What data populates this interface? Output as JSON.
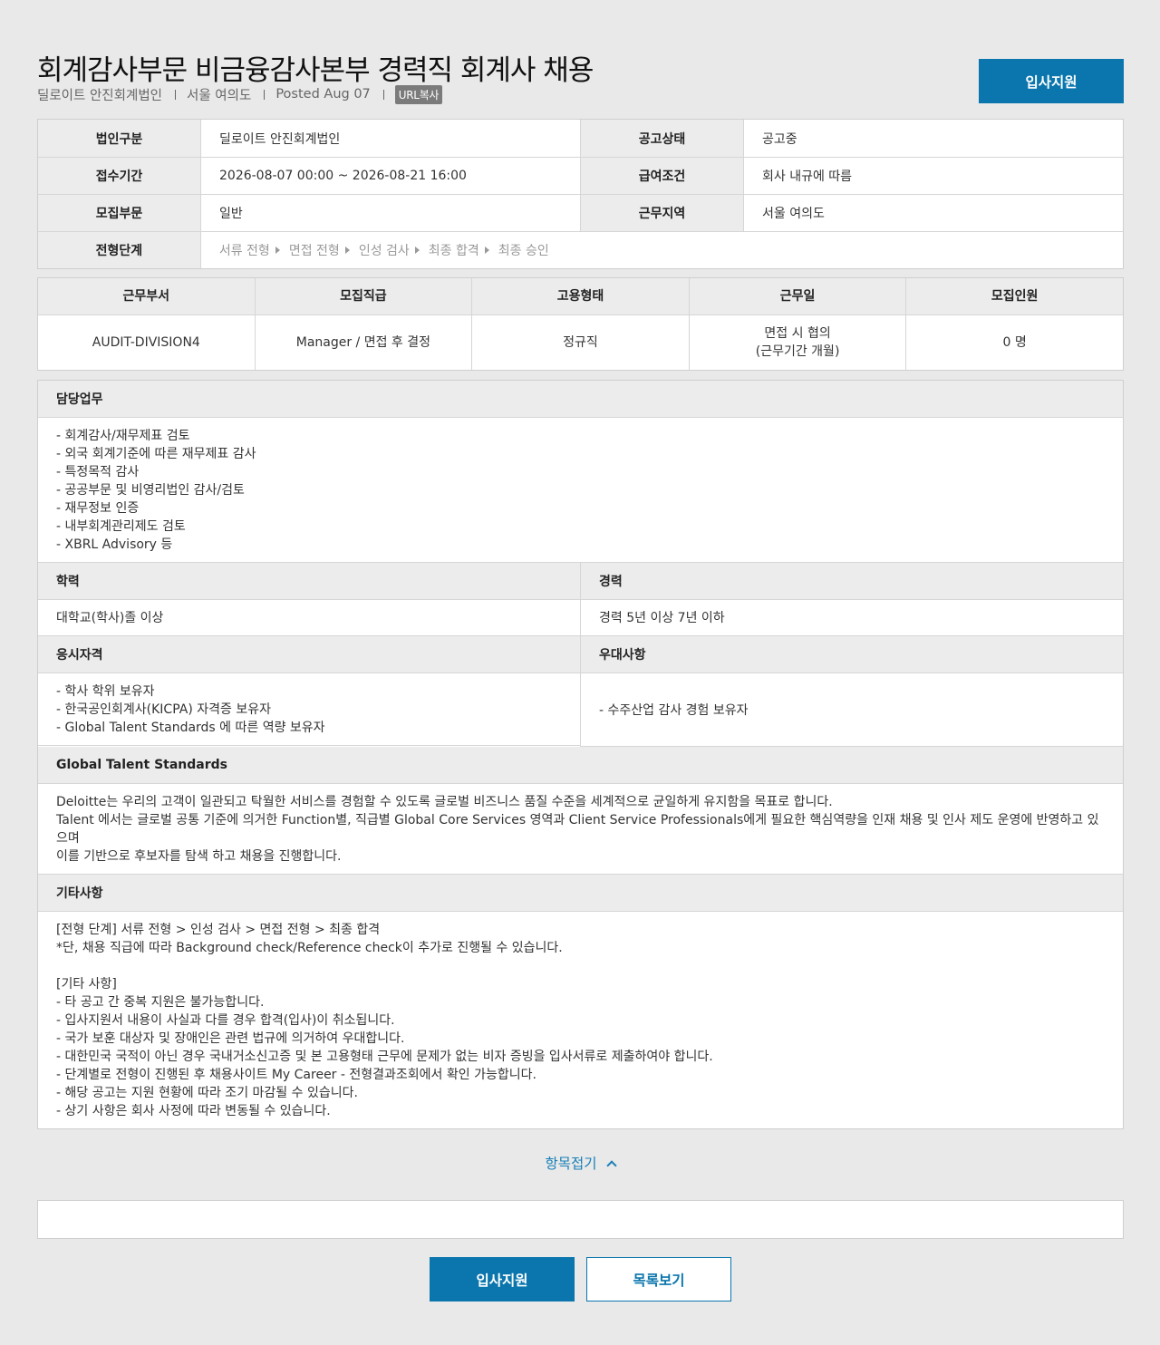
{
  "header": {
    "title": "회계감사부문 비금융감사본부 경력직 회계사 채용",
    "company": "딜로이트 안진회계법인",
    "location": "서울 여의도",
    "posted": "Posted Aug 07",
    "url_copy": "URL복사",
    "apply_label": "입사지원"
  },
  "info": {
    "corp_label": "법인구분",
    "corp_value": "딜로이트 안진회계법인",
    "status_label": "공고상태",
    "status_value": "공고중",
    "period_label": "접수기간",
    "period_value": "2026-08-07 00:00 ~ 2026-08-21 16:00",
    "salary_label": "급여조건",
    "salary_value": "회사 내규에 따름",
    "dept_label": "모집부문",
    "dept_value": "일반",
    "region_label": "근무지역",
    "region_value": "서울 여의도",
    "steps_label": "전형단계",
    "steps": [
      "서류 전형",
      "면접 전형",
      "인성 검사",
      "최종 합격",
      "최종 승인"
    ]
  },
  "positions": {
    "headers": [
      "근무부서",
      "모집직급",
      "고용형태",
      "근무일",
      "모집인원"
    ],
    "row": {
      "dept": "AUDIT-DIVISION4",
      "rank": "Manager / 면접 후 결정",
      "type": "정규직",
      "workday_1": "면접 시 협의",
      "workday_2": "(근무기간 개월)",
      "count": "0 명"
    }
  },
  "duties": {
    "title": "담당업무",
    "lines": [
      "- 회계감사/재무제표 검토",
      "- 외국 회계기준에 따른 재무제표 감사",
      "- 특정목적 감사",
      "- 공공부문 및 비영리법인 감사/검토",
      "- 재무정보 인증",
      "- 내부회계관리제도 검토",
      "- XBRL Advisory 등"
    ]
  },
  "education": {
    "title": "학력",
    "value": "대학교(학사)졸 이상"
  },
  "career": {
    "title": "경력",
    "value": "경력 5년 이상 7년 이하"
  },
  "qualification": {
    "title": "응시자격",
    "lines": [
      "- 학사 학위 보유자",
      "- 한국공인회계사(KICPA) 자격증 보유자",
      "- Global Talent Standards 에 따른 역량 보유자"
    ]
  },
  "preference": {
    "title": "우대사항",
    "value": "- 수주산업 감사 경험 보유자"
  },
  "gts": {
    "title": "Global Talent Standards",
    "lines": [
      "Deloitte는 우리의 고객이 일관되고 탁월한 서비스를 경험할 수 있도록 글로벌 비즈니스 품질 수준을 세계적으로 균일하게 유지함을 목표로 합니다.",
      "Talent 에서는 글로벌 공통 기준에 의거한 Function별, 직급별 Global Core Services 영역과 Client Service Professionals에게 필요한 핵심역량을 인재 채용 및 인사 제도 운영에 반영하고 있으며",
      "이를 기반으로 후보자를 탐색 하고 채용을 진행합니다."
    ]
  },
  "etc": {
    "title": "기타사항",
    "lines": [
      "[전형 단계] 서류 전형 > 인성 검사 > 면접 전형 > 최종 합격",
      "*단, 채용 직급에 따라 Background check/Reference check이 추가로 진행될 수 있습니다.",
      "",
      "[기타 사항]",
      "- 타 공고 간 중복 지원은 불가능합니다.",
      "- 입사지원서 내용이 사실과 다를 경우 합격(입사)이 취소됩니다.",
      "- 국가 보훈 대상자 및 장애인은 관련 법규에 의거하여 우대합니다.",
      "- 대한민국 국적이 아닌 경우 국내거소신고증 및 본 고용형태 근무에 문제가 없는 비자 증빙을 입사서류로 제출하여야 합니다.",
      "- 단계별로 전형이 진행된 후 채용사이트 My Career - 전형결과조회에서 확인 가능합니다.",
      "- 해당 공고는 지원 현황에 따라 조기 마감될 수 있습니다.",
      "- 상기 사항은 회사 사정에 따라 변동될 수 있습니다."
    ]
  },
  "footer": {
    "fold_label": "항목접기",
    "apply_label": "입사지원",
    "list_label": "목록보기"
  },
  "colors": {
    "accent": "#0a76ad",
    "link": "#1a7fb8",
    "background": "#e8e9e8"
  }
}
